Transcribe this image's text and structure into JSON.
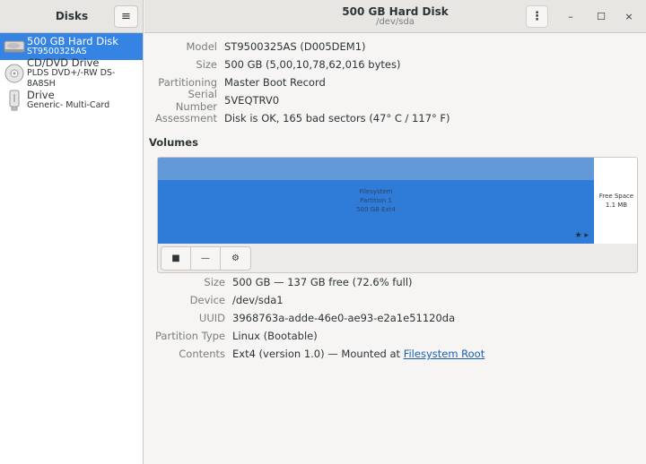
{
  "sidebar": {
    "title": "Disks",
    "menu_icon": "hamburger-menu-icon",
    "disks": [
      {
        "name": "500 GB Hard Disk",
        "sub": "ST9500325AS",
        "icon": "hard-disk-icon",
        "selected": true
      },
      {
        "name": "CD/DVD Drive",
        "sub": "PLDS DVD+/-RW DS-8A8SH",
        "icon": "optical-drive-icon",
        "selected": false
      },
      {
        "name": "Drive",
        "sub": "Generic- Multi-Card",
        "icon": "usb-drive-icon",
        "selected": false
      }
    ]
  },
  "header": {
    "title": "500 GB Hard Disk",
    "subtitle": "/dev/sda",
    "minimize": "–",
    "maximize": "☐",
    "close": "×"
  },
  "disk_props": [
    {
      "label": "Model",
      "value": "ST9500325AS (D005DEM1)"
    },
    {
      "label": "Size",
      "value": "500 GB (5,00,10,78,62,016 bytes)"
    },
    {
      "label": "Partitioning",
      "value": "Master Boot Record"
    },
    {
      "label": "Serial Number",
      "value": "5VEQTRV0"
    },
    {
      "label": "Assessment",
      "value": "Disk is OK, 165 bad sectors (47° C / 117° F)"
    }
  ],
  "volumes": {
    "title": "Volumes",
    "partition": {
      "line1": "Filesystem",
      "line2": "Partition 1",
      "line3": "500 GB Ext4",
      "icons": "★ ▸",
      "color": "#2f7bd8"
    },
    "free_space": {
      "line1": "Free Space",
      "line2": "1.1 MB"
    },
    "toolbar": {
      "stop": "■",
      "remove": "—",
      "settings": "⚙"
    }
  },
  "volume_props": [
    {
      "label": "Size",
      "value": "500 GB — 137 GB free (72.6% full)"
    },
    {
      "label": "Device",
      "value": "/dev/sda1"
    },
    {
      "label": "UUID",
      "value": "3968763a-adde-46e0-ae93-e2a1e51120da"
    },
    {
      "label": "Partition Type",
      "value": "Linux (Bootable)"
    },
    {
      "label": "Contents",
      "value": "Ext4 (version 1.0) — Mounted at ",
      "link": "Filesystem Root"
    }
  ]
}
